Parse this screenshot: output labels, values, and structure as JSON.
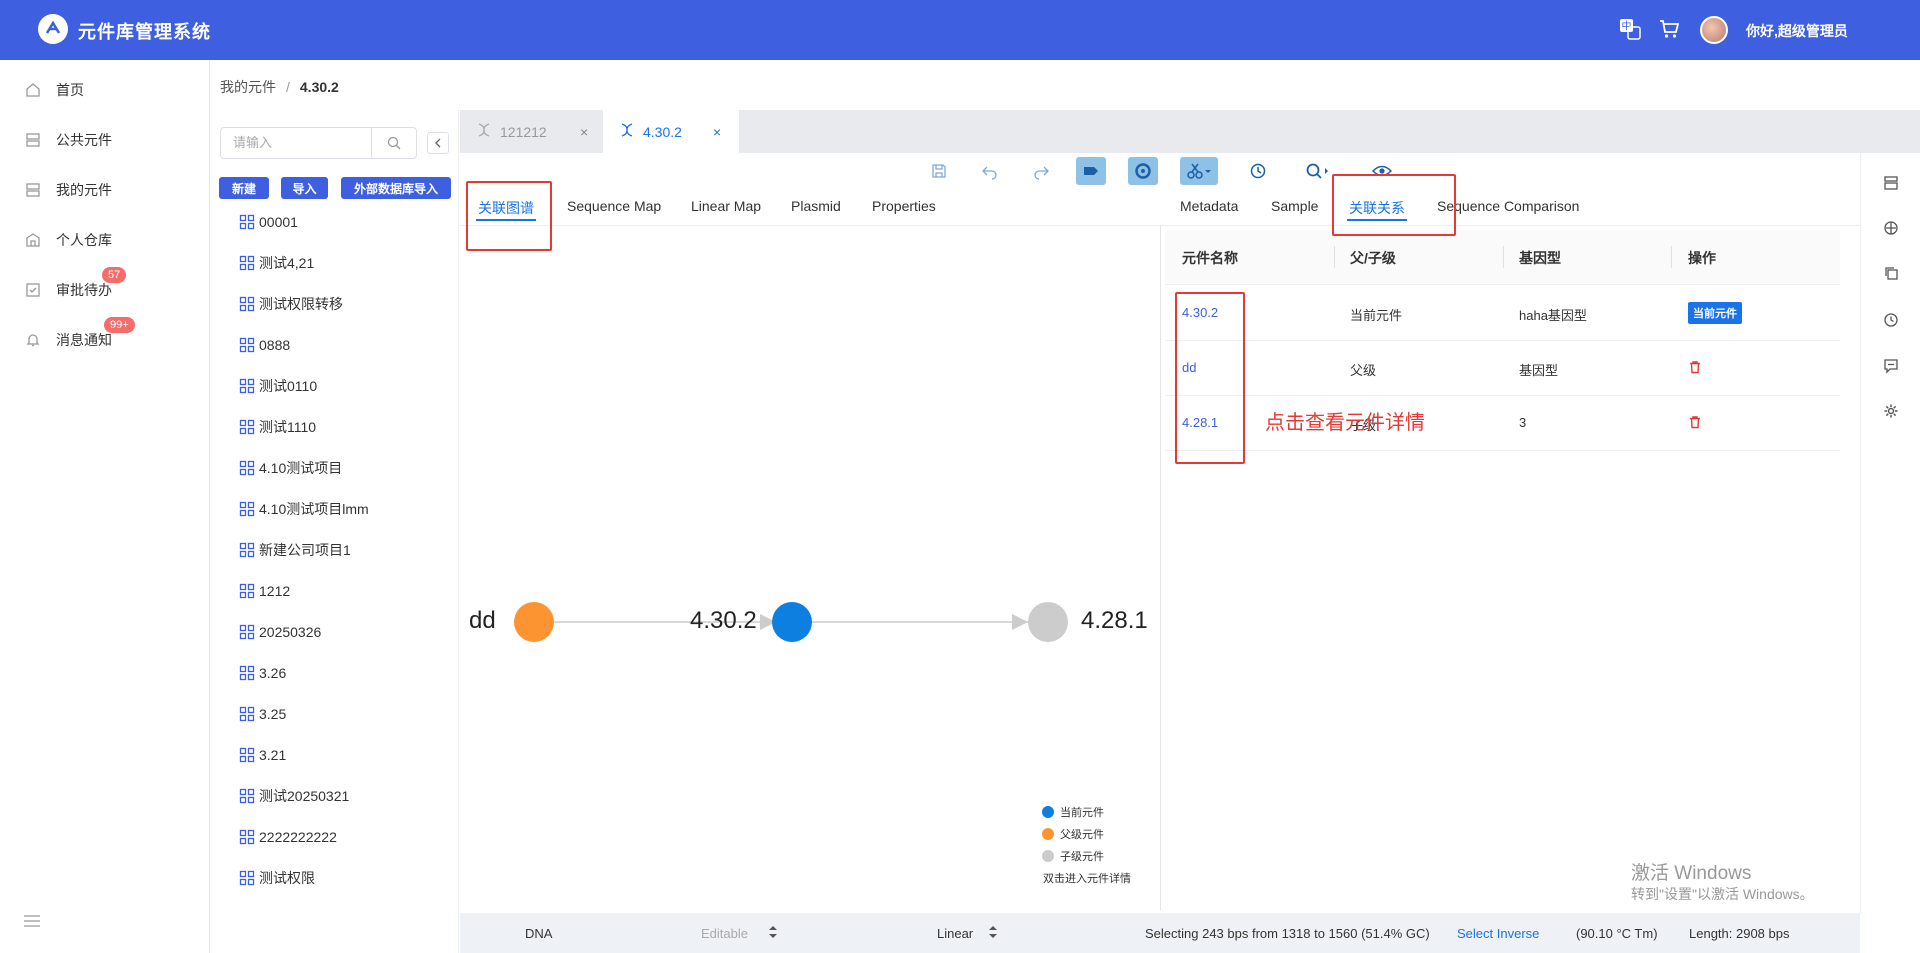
{
  "header": {
    "app_title": "元件库管理系统",
    "greeting": "你好,超级管理员"
  },
  "menu": {
    "items": [
      {
        "label": "首页",
        "icon": "home-icon"
      },
      {
        "label": "公共元件",
        "icon": "database-icon"
      },
      {
        "label": "我的元件",
        "icon": "database-icon"
      },
      {
        "label": "个人仓库",
        "icon": "warehouse-icon"
      },
      {
        "label": "审批待办",
        "icon": "approval-icon",
        "badge": "57"
      },
      {
        "label": "消息通知",
        "icon": "bell-icon",
        "badge": "99+"
      }
    ]
  },
  "breadcrumb": {
    "parent": "我的元件",
    "separator": "/",
    "current": "4.30.2"
  },
  "tree": {
    "search_placeholder": "请输入",
    "buttons": {
      "new": "新建",
      "import": "导入",
      "external_import": "外部数据库导入"
    },
    "items": [
      "00001",
      "测试4,21",
      "测试权限转移",
      "0888",
      "测试0110",
      "测试1110",
      "4.10测试项目",
      "4.10测试项目lmm",
      "新建公司项目1",
      "1212",
      "20250326",
      "3.26",
      "3.25",
      "3.21",
      "测试20250321",
      "2222222222",
      "测试权限"
    ]
  },
  "doc_tabs": [
    {
      "label": "121212",
      "active": false
    },
    {
      "label": "4.30.2",
      "active": true
    }
  ],
  "view_tabs_left": [
    "关联图谱",
    "Sequence Map",
    "Linear Map",
    "Plasmid",
    "Properties"
  ],
  "view_tabs_right": [
    "Metadata",
    "Sample",
    "关联关系",
    "Sequence Comparison"
  ],
  "graph": {
    "nodes": [
      {
        "label": "dd",
        "color": "#fb9431"
      },
      {
        "label": "4.30.2",
        "color": "#0d7fe0"
      },
      {
        "label": "4.28.1",
        "color": "#cccccc"
      }
    ],
    "legend": [
      {
        "label": "当前元件",
        "color": "#0d7fe0"
      },
      {
        "label": "父级元件",
        "color": "#fb9431"
      },
      {
        "label": "子级元件",
        "color": "#cccccc"
      }
    ],
    "hint": "双击进入元件详情"
  },
  "table": {
    "headers": [
      "元件名称",
      "父/子级",
      "基因型",
      "操作"
    ],
    "rows": [
      {
        "name": "4.30.2",
        "relation": "当前元件",
        "genotype": "haha基因型",
        "action": "当前元件"
      },
      {
        "name": "dd",
        "relation": "父级",
        "genotype": "基因型",
        "action": "delete"
      },
      {
        "name": "4.28.1",
        "relation": "子级",
        "genotype": "3",
        "action": "delete"
      }
    ],
    "annotation": "点击查看元件详情"
  },
  "statusbar": {
    "type": "DNA",
    "editable": "Editable",
    "topology": "Linear",
    "selection": "Selecting 243 bps from 1318 to 1560 (51.4% GC)",
    "select_inverse": "Select Inverse",
    "tm": "(90.10 °C Tm)",
    "length": "Length: 2908 bps"
  },
  "watermark": {
    "line1": "激活 Windows",
    "line2": "转到\"设置\"以激活 Windows。"
  },
  "colors": {
    "brand": "#3d5fe0",
    "accent": "#1a73e8",
    "annotation_red": "#e53935"
  }
}
